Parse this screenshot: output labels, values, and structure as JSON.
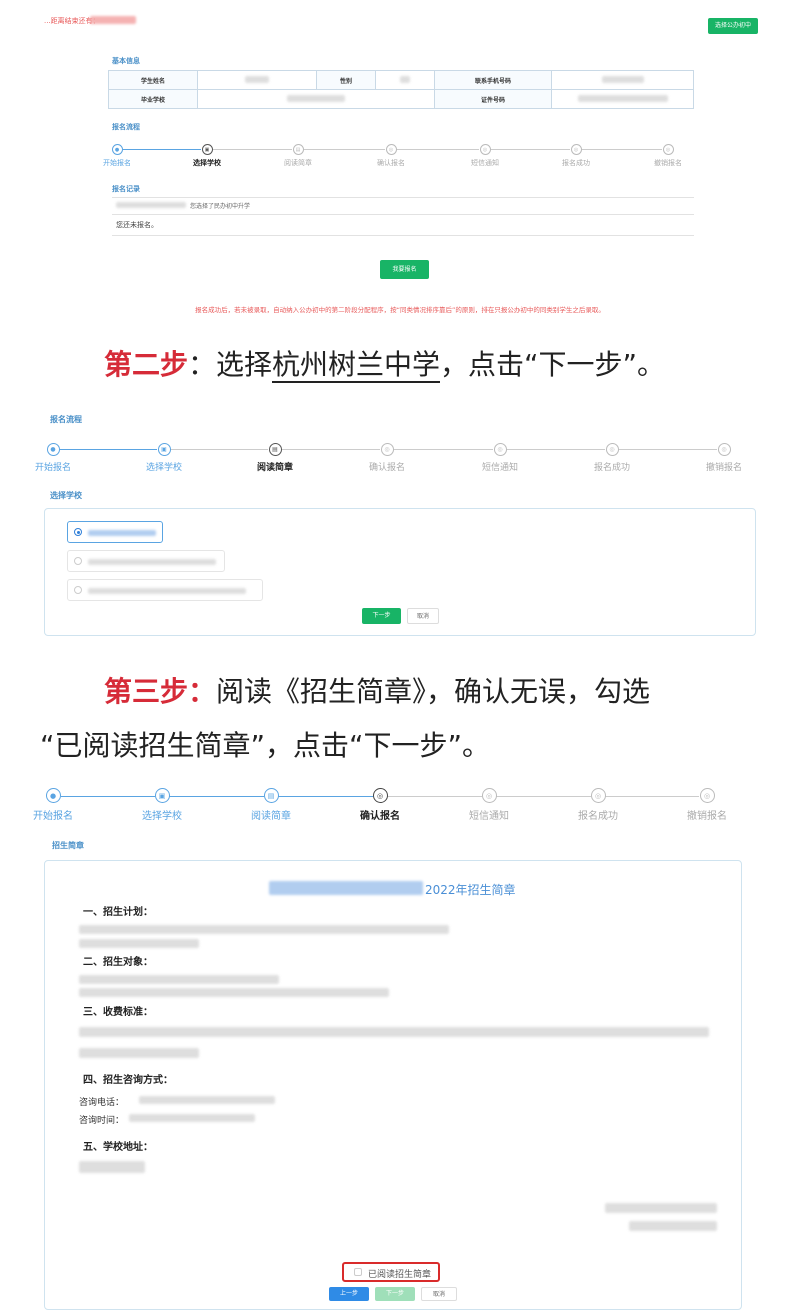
{
  "panel1": {
    "top_note": "...距离结束还有：",
    "select_public_button": "选择公办初中",
    "basic_info_title": "基本信息",
    "table": {
      "student_name_label": "学生姓名",
      "gender_label": "性别",
      "phone_label": "联系手机号码",
      "school_label": "毕业学校",
      "id_label": "证件号码"
    },
    "process_title": "报名流程",
    "steps": [
      "开始报名",
      "选择学校",
      "阅读简章",
      "确认报名",
      "短信通知",
      "报名成功",
      "撤销报名"
    ],
    "record_title": "报名记录",
    "record_text": "您选择了民办初中升学",
    "not_applied": "您还未报名。",
    "apply_button": "我要报名",
    "notice": "报名成功后，若未被录取，自动纳入公办初中的第二阶段分配程序，按“同类情况排序靠后”的原则，排在只报公办初中的同类别学生之后录取。"
  },
  "caption2": {
    "prefix": "第二步",
    "text1": "：选择",
    "school": "杭州树兰中学",
    "text2": "，点击“下一步”。"
  },
  "panel2": {
    "process_title": "报名流程",
    "steps": [
      "开始报名",
      "选择学校",
      "阅读简章",
      "确认报名",
      "短信通知",
      "报名成功",
      "撤销报名"
    ],
    "select_school_title": "选择学校",
    "next_button": "下一步",
    "cancel_button": "取消"
  },
  "caption3": {
    "prefix": "第三步：",
    "line1": "阅读《招生简章》，确认无误，勾选",
    "line2": "“已阅读招生简章”，点击“下一步”。"
  },
  "panel3": {
    "steps": [
      "开始报名",
      "选择学校",
      "阅读简章",
      "确认报名",
      "短信通知",
      "报名成功",
      "撤销报名"
    ],
    "brochure_label": "招生简章",
    "brochure_title": "2022年招生简章",
    "sections": [
      "一、招生计划：",
      "二、招生对象：",
      "三、收费标准：",
      "四、招生咨询方式：",
      "五、学校地址："
    ],
    "phone_label": "咨询电话：",
    "time_label": "咨询时间：",
    "read_checkbox": "已阅读招生简章",
    "prev_button": "上一步",
    "next_button": "下一步",
    "cancel_button": "取消"
  },
  "colors": {
    "accent_green": "#18b466",
    "accent_blue": "#5aa4e2",
    "caption_red": "#d62b38",
    "notice_red": "#e85b5b"
  }
}
